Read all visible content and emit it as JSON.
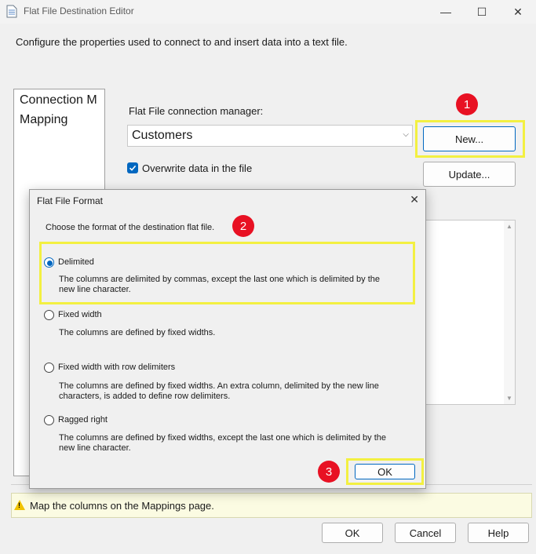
{
  "window": {
    "title": "Flat File Destination Editor",
    "minimize_glyph": "—",
    "maximize_glyph": "☐",
    "close_glyph": "✕",
    "intro": "Configure the properties used to connect to and insert data into a text file."
  },
  "sidebar": {
    "items": [
      {
        "label": "Connection M"
      },
      {
        "label": "Mapping"
      }
    ]
  },
  "connection": {
    "label": "Flat File connection manager:",
    "value": "Customers",
    "dropdown_glyph": "⌵",
    "new_button": "New...",
    "update_button": "Update...",
    "overwrite_label": "Overwrite data in the file",
    "overwrite_checked": true
  },
  "callouts": [
    "1",
    "2",
    "3"
  ],
  "dialog": {
    "title": "Flat File Format",
    "close_glyph": "✕",
    "intro": "Choose the format of the destination flat file.",
    "options": [
      {
        "label": "Delimited",
        "description": "The columns are delimited by commas, except the last one which is delimited by the new line character.",
        "selected": true
      },
      {
        "label": "Fixed width",
        "description": "The columns are defined by fixed widths.",
        "selected": false
      },
      {
        "label": "Fixed width with row delimiters",
        "description": "The columns are defined by fixed widths. An extra column, delimited by the new line characters, is added to define row delimiters.",
        "selected": false
      },
      {
        "label": "Ragged right",
        "description": "The columns are defined by fixed widths, except the last one which is delimited by the new line character.",
        "selected": false
      }
    ],
    "ok_button": "OK"
  },
  "status": {
    "message": "Map the columns on the Mappings page.",
    "warning_mark": "!"
  },
  "footer": {
    "ok": "OK",
    "cancel": "Cancel",
    "help": "Help"
  },
  "colors": {
    "accent": "#0067c0",
    "highlight": "#f3f041",
    "badge": "#e81123",
    "status_background": "#fbfbe2"
  },
  "icons": {
    "app": "document-icon",
    "warning": "warning-triangle-icon",
    "scroll_up": "scroll-up-arrow-icon",
    "scroll_down": "scroll-down-arrow-icon"
  }
}
